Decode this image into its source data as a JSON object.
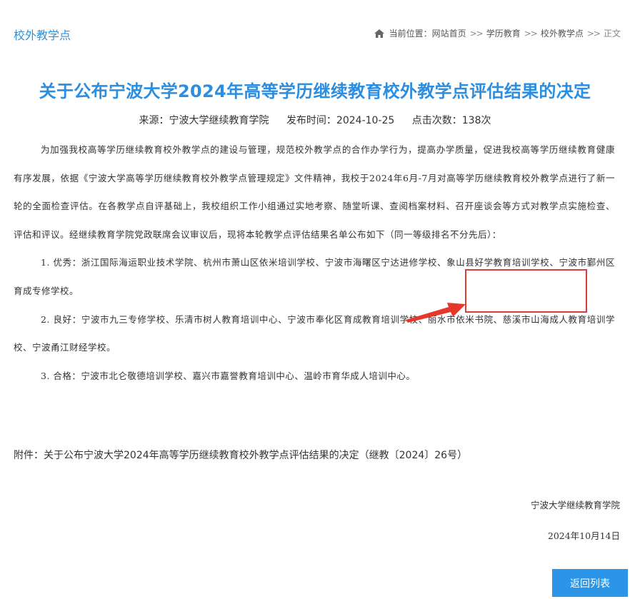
{
  "header": {
    "section_title": "校外教学点",
    "breadcrumb": {
      "prefix": "当前位置：",
      "items": [
        "网站首页",
        "学历教育",
        "校外教学点",
        "正文"
      ],
      "separator": ">>"
    }
  },
  "article": {
    "title": "关于公布宁波大学2024年高等学历继续教育校外教学点评估结果的决定",
    "meta": {
      "source": "来源：宁波大学继续教育学院",
      "publish_time": "发布时间：2024-10-25",
      "clicks": "点击次数：138次"
    },
    "intro": "为加强我校高等学历继续教育校外教学点的建设与管理，规范校外教学点的合作办学行为，提高办学质量，促进我校高等学历继续教育健康有序发展，依据《宁波大学高等学历继续教育校外教学点管理规定》文件精神，我校于2024年6月-7月对高等学历继续教育校外教学点进行了新一轮的全面检查评估。在各教学点自评基础上，我校组织工作小组通过实地考察、随堂听课、查阅档案材料、召开座谈会等方式对教学点实施检查、评估和评议。经继续教育学院党政联席会议审议后，现将本轮教学点评估结果名单公布如下（同一等级排名不分先后）：",
    "results": [
      "1. 优秀：浙江国际海运职业技术学院、杭州市萧山区依米培训学校、宁波市海曙区宁达进修学校、象山县好学教育培训学校、宁波市鄞州区育成专修学校。",
      "2. 良好：宁波市九三专修学校、乐清市树人教育培训中心、宁波市奉化区育成教育培训学校、丽水市依米书院、慈溪市山海成人教育培训学校、宁波甬江财经学校。",
      "3. 合格：宁波市北仑敬德培训学校、嘉兴市嘉誉教育培训中心、温岭市育华成人培训中心。"
    ],
    "attachment": "附件：关于公布宁波大学2024年高等学历继续教育校外教学点评估结果的决定（继教〔2024〕26号）",
    "signature_org": "宁波大学继续教育学院",
    "signature_date": "2024年10月14日"
  },
  "actions": {
    "back_label": "返回列表"
  },
  "colors": {
    "accent": "#2b8ee0",
    "button": "#2b95e8",
    "highlight": "#e03c31"
  }
}
